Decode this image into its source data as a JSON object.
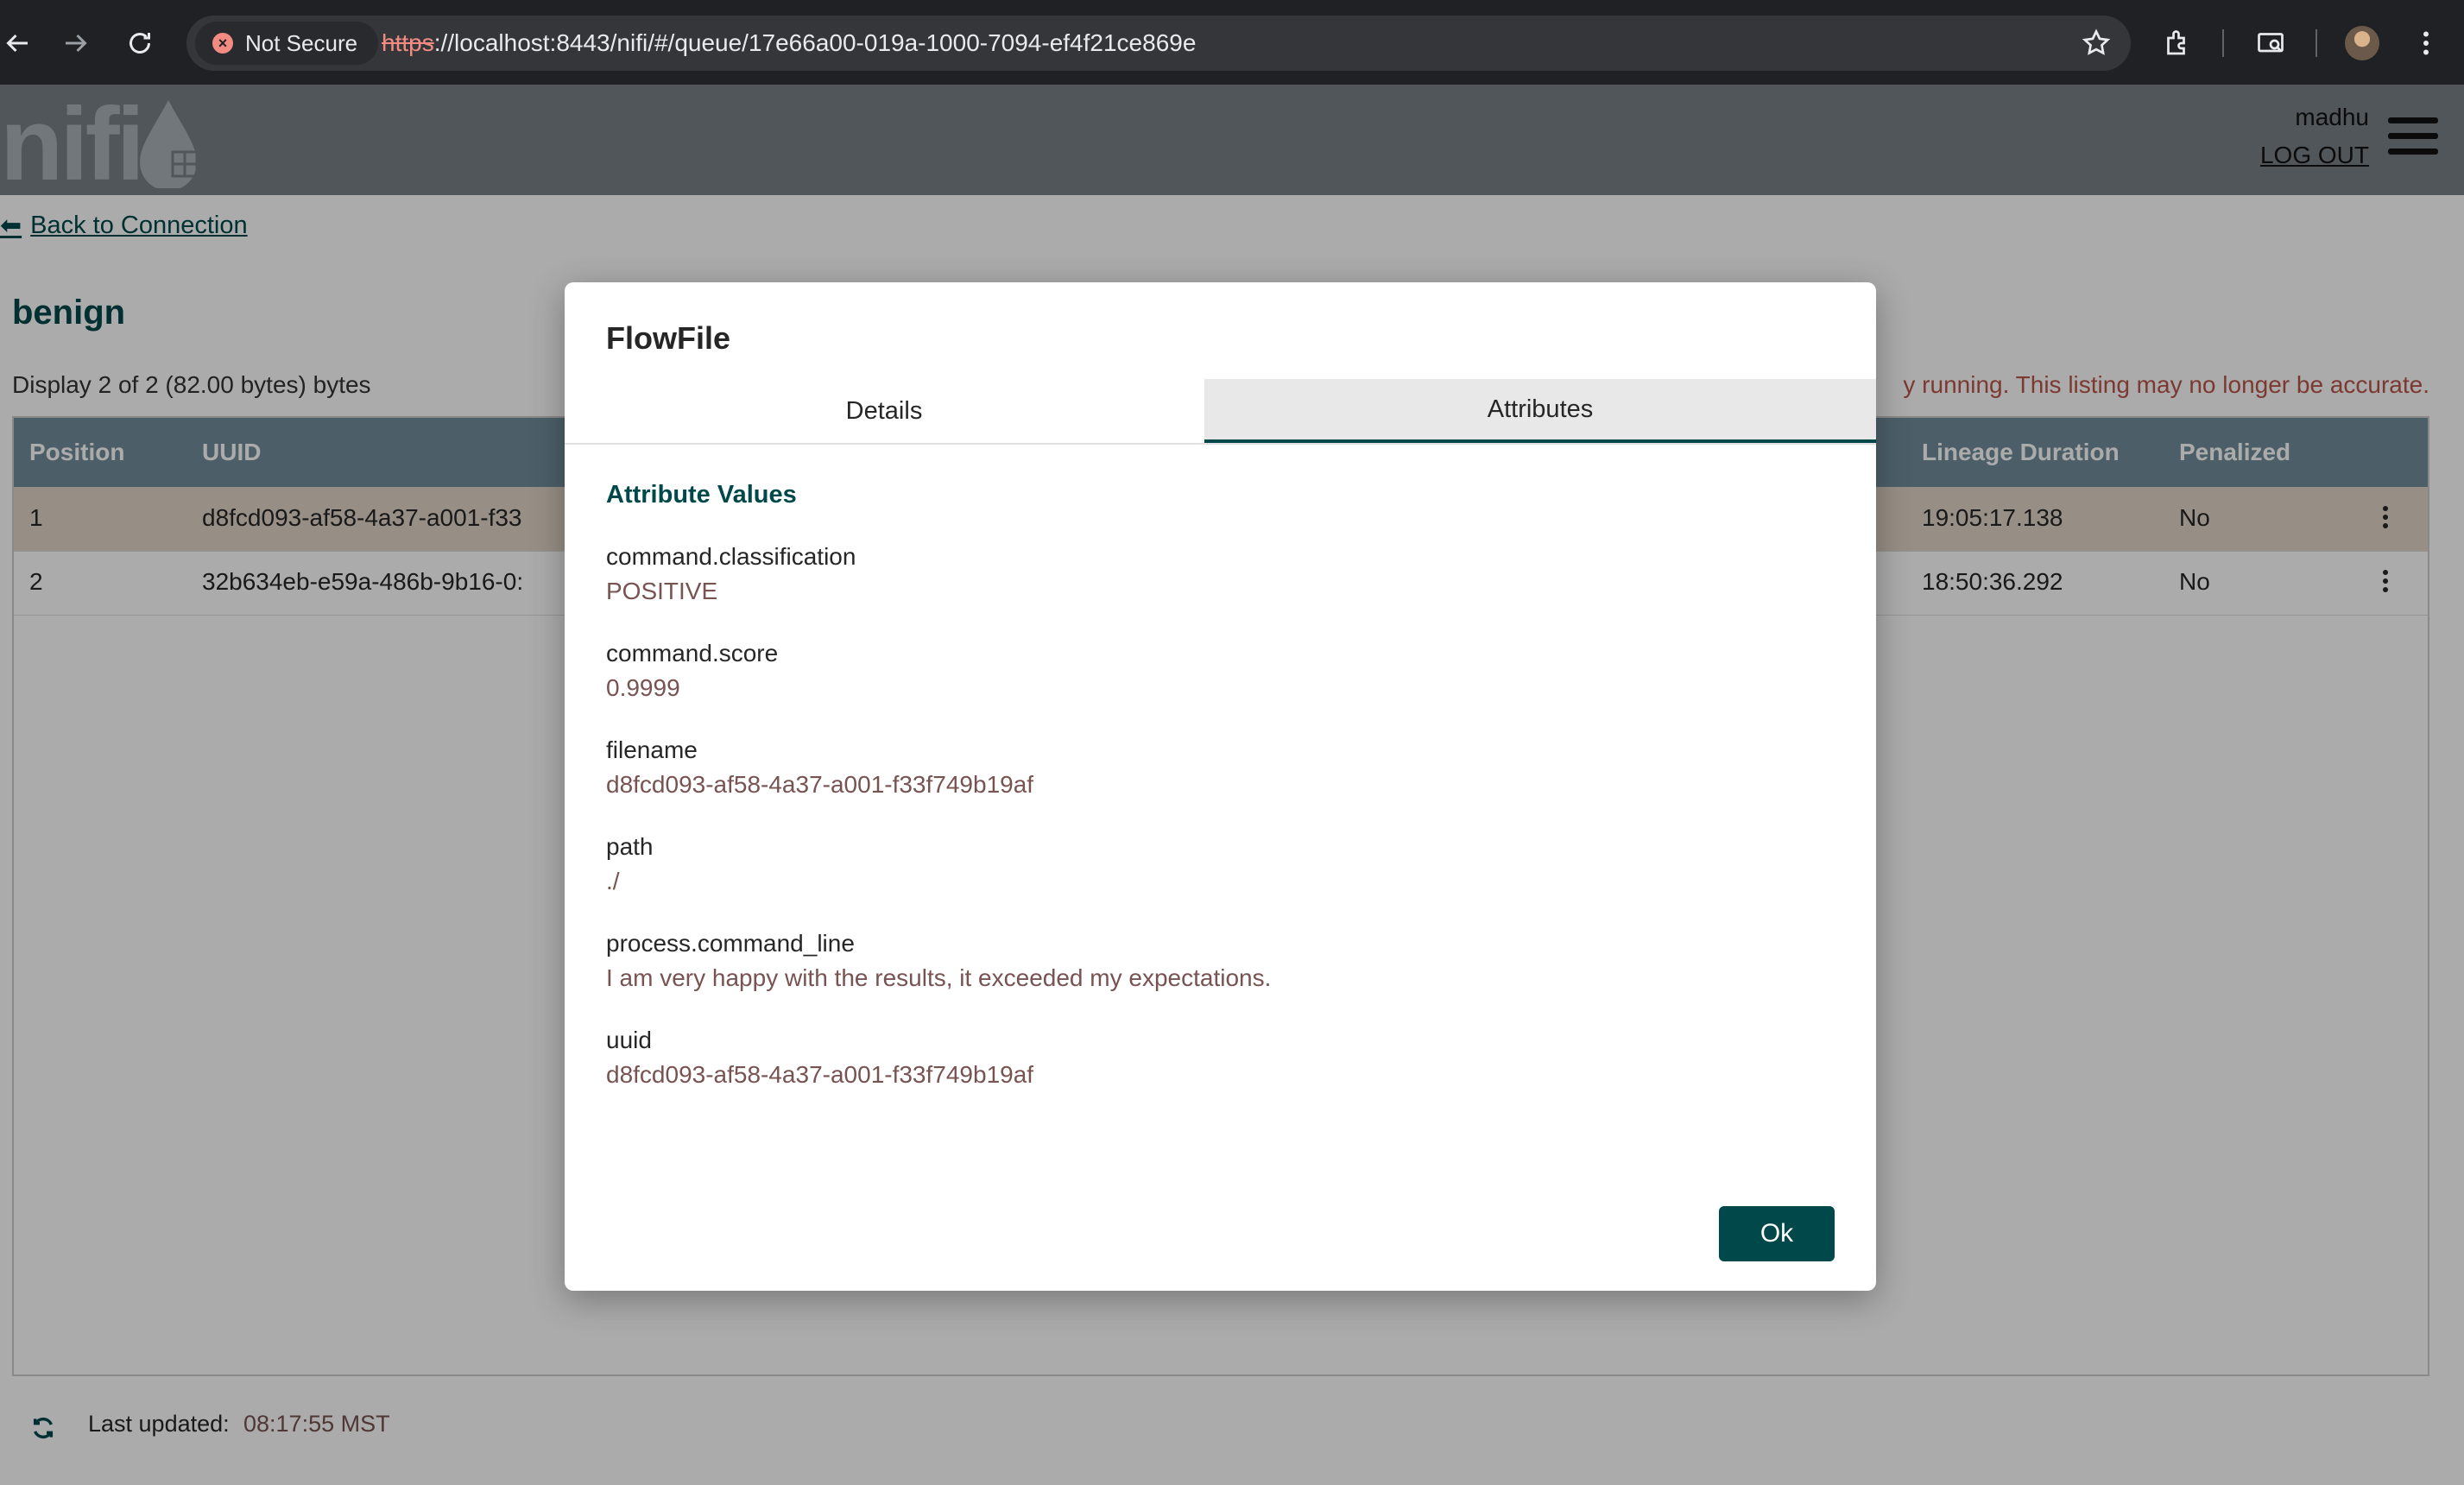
{
  "browser": {
    "security_label": "Not Secure",
    "url_scheme": "https",
    "url_rest": "://localhost:8443/nifi/#/queue/17e66a00-019a-1000-7094-ef4f21ce869e"
  },
  "header": {
    "logo_text": "nifi",
    "username": "madhu",
    "logout_label": "LOG OUT"
  },
  "page": {
    "back_link": "Back to Connection",
    "queue_name": "benign",
    "display_text": "Display 2 of 2 (82.00 bytes) bytes",
    "warning_text": "y running. This listing may no longer be accurate.",
    "columns": {
      "position": "Position",
      "uuid": "UUID",
      "lineage_duration": "Lineage Duration",
      "penalized": "Penalized"
    },
    "rows": [
      {
        "position": "1",
        "uuid": "d8fcd093-af58-4a37-a001-f33",
        "lineage": "19:05:17.138",
        "penalized": "No"
      },
      {
        "position": "2",
        "uuid": "32b634eb-e59a-486b-9b16-0:",
        "lineage": "18:50:36.292",
        "penalized": "No"
      }
    ],
    "last_updated_label": "Last updated:",
    "last_updated_value": "08:17:55 MST"
  },
  "dialog": {
    "title": "FlowFile",
    "tabs": [
      "Details",
      "Attributes"
    ],
    "active_tab": "Attributes",
    "section_title": "Attribute Values",
    "attributes": [
      {
        "key": "command.classification",
        "value": "POSITIVE"
      },
      {
        "key": "command.score",
        "value": "0.9999"
      },
      {
        "key": "filename",
        "value": "d8fcd093-af58-4a37-a001-f33f749b19af"
      },
      {
        "key": "path",
        "value": "./"
      },
      {
        "key": "process.command_line",
        "value": "I am very happy with the results, it exceeded my expectations."
      },
      {
        "key": "uuid",
        "value": "d8fcd093-af58-4a37-a001-f33f749b19af"
      }
    ],
    "ok_label": "Ok"
  },
  "colors": {
    "nifi_teal": "#004849",
    "header_gray": "#7a8188",
    "table_header": "#728e9b",
    "value_brown": "#775351"
  }
}
